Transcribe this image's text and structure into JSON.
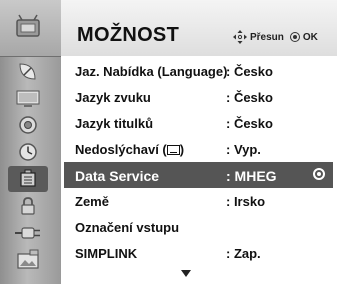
{
  "header": {
    "title": "MOŽNOST",
    "hint_move": "Přesun",
    "hint_ok": "OK"
  },
  "sidebar": {
    "items": [
      {
        "icon": "setup-tv-icon"
      },
      {
        "icon": "satellite-dish-icon"
      },
      {
        "icon": "screen-picture-icon"
      },
      {
        "icon": "speaker-audio-icon"
      },
      {
        "icon": "clock-time-icon"
      },
      {
        "icon": "option-box-icon",
        "active": true
      },
      {
        "icon": "lock-icon"
      },
      {
        "icon": "input-plug-icon"
      },
      {
        "icon": "usb-photo-icon"
      }
    ]
  },
  "rows": [
    {
      "label": "Jaz. Nabídka (Language)",
      "value": ": Česko"
    },
    {
      "label": "Jazyk zvuku",
      "value": ": Česko"
    },
    {
      "label": "Jazyk titulků",
      "value": ": Česko"
    },
    {
      "label": "Nedoslýchaví (",
      "label_suffix": ")",
      "value": ": Vyp."
    },
    {
      "label": "Data Service",
      "value": ": MHEG",
      "selected": true
    },
    {
      "label": "Země",
      "value": ": Irsko"
    },
    {
      "label": "Označení vstupu",
      "value": ""
    },
    {
      "label": "SIMPLINK",
      "value": ": Zap."
    }
  ]
}
